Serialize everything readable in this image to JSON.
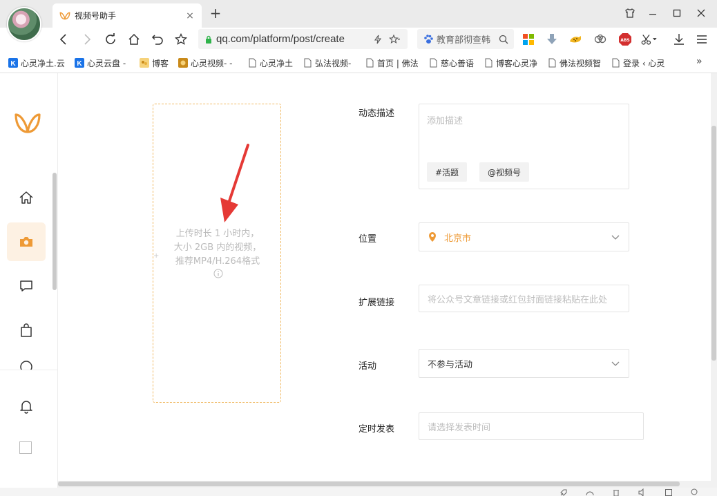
{
  "browser": {
    "tab_title": "视频号助手",
    "tab_close": "×",
    "new_tab": "+",
    "url": "qq.com/platform/post/create",
    "search_text": "教育部彻查韩",
    "bookmarks_more": "»",
    "bookmarks": [
      {
        "label": "心灵净土.云",
        "icon": "k-icon",
        "color": "#1a73e8"
      },
      {
        "label": "心灵云盘 -",
        "icon": "k-icon",
        "color": "#1a73e8"
      },
      {
        "label": "博客",
        "icon": "blog-icon",
        "color": "#e8b03a"
      },
      {
        "label": "心灵视频- -",
        "icon": "video-icon",
        "color": "#c98a1a"
      },
      {
        "label": "心灵净土",
        "icon": "page-icon",
        "color": "#666666"
      },
      {
        "label": "弘法视频-",
        "icon": "page-icon",
        "color": "#666666"
      },
      {
        "label": "首页 | 佛法",
        "icon": "page-icon",
        "color": "#666666"
      },
      {
        "label": "慈心善语",
        "icon": "page-icon",
        "color": "#666666"
      },
      {
        "label": "博客心灵净",
        "icon": "page-icon",
        "color": "#666666"
      },
      {
        "label": "佛法视频智",
        "icon": "page-icon",
        "color": "#666666"
      },
      {
        "label": "登录 ‹ 心灵",
        "icon": "page-icon",
        "color": "#666666"
      }
    ]
  },
  "sidebar": {
    "items": [
      {
        "name": "home-icon"
      },
      {
        "name": "camera-icon",
        "active": true
      },
      {
        "name": "message-icon"
      },
      {
        "name": "shopping-bag-icon"
      },
      {
        "name": "bell-icon"
      }
    ]
  },
  "upload": {
    "line1": "上传时长 1 小时内，",
    "line2": "大小 2GB 内的视频，",
    "line3": "推荐MP4/H.264格式",
    "plus": "+"
  },
  "form": {
    "description": {
      "label": "动态描述",
      "placeholder": "添加描述",
      "chip_topic": "#活题",
      "chip_channel": "@视频号"
    },
    "location": {
      "label": "位置",
      "value": "北京市"
    },
    "extended_link": {
      "label": "扩展链接",
      "placeholder": "将公众号文章链接或红包封面链接粘贴在此处"
    },
    "activity": {
      "label": "活动",
      "value": "不参与活动"
    },
    "schedule": {
      "label": "定时发表",
      "placeholder": "请选择发表时间"
    }
  },
  "colors": {
    "accent": "#ee9a36",
    "upload_border": "#f0b860",
    "arrow": "#e53935"
  }
}
